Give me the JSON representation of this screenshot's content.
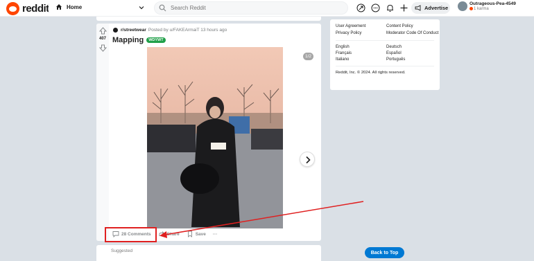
{
  "header": {
    "logo_text": "reddit",
    "home_label": "Home",
    "search_placeholder": "Search Reddit",
    "advertise_label": "Advertise",
    "username": "Outrageous-Pea-4549",
    "karma": "1 karma"
  },
  "post": {
    "subreddit": "r/streetwear",
    "posted_by": "Posted by u/FAKEArmaiT 13 hours ago",
    "vote_count": "407",
    "title": "Mapping",
    "flair": "WDYWT",
    "image_counter": "1/2",
    "actions": {
      "comments": "28 Comments",
      "share": "Share",
      "save": "Save",
      "more": "···"
    }
  },
  "suggested_label": "Suggested",
  "sidebar": {
    "links": [
      "User Agreement",
      "Content Policy",
      "Privacy Policy",
      "Moderator Code Of Conduct"
    ],
    "languages": [
      "English",
      "Deutsch",
      "Français",
      "Español",
      "Italiano",
      "Português"
    ],
    "copyright": "Reddit, Inc. © 2024. All rights reserved."
  },
  "back_to_top": "Back to Top",
  "colors": {
    "brand": "#ff4500",
    "accent": "#0079d3",
    "flair": "#21a04a",
    "annotation": "#e02020"
  }
}
